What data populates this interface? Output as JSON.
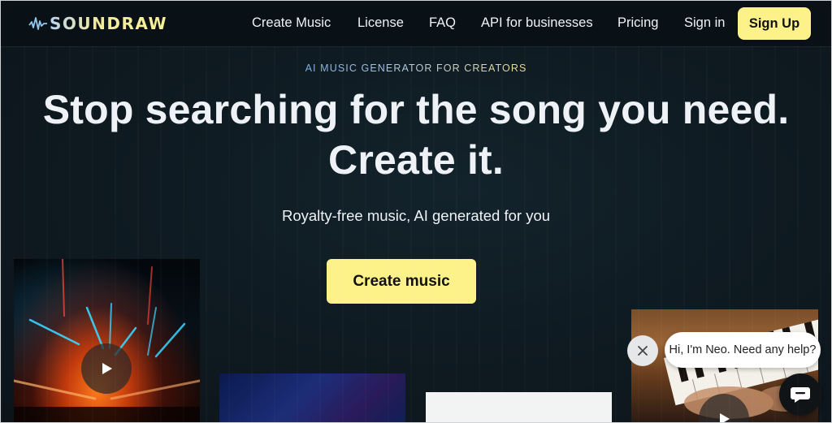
{
  "brand": {
    "name": "SOUNDRAW"
  },
  "nav": {
    "links": [
      "Create Music",
      "License",
      "FAQ",
      "API for businesses",
      "Pricing",
      "Sign in"
    ],
    "signup_label": "Sign Up"
  },
  "hero": {
    "eyebrow": "AI MUSIC GENERATOR FOR CREATORS",
    "headline_line1": "Stop searching for the song you need.",
    "headline_line2": "Create it.",
    "subhead": "Royalty-free music, AI generated for you",
    "cta_label": "Create music"
  },
  "chat": {
    "message": "Hi, I'm Neo. Need any help?",
    "close_icon": "close-icon",
    "launcher_icon": "chat-icon"
  },
  "colors": {
    "accent_yellow": "#fdf28a",
    "background": "#0e1820",
    "nav_background": "#0a1116"
  },
  "cards": [
    {
      "kind": "concert",
      "icon": "play-icon"
    },
    {
      "kind": "blue"
    },
    {
      "kind": "white"
    },
    {
      "kind": "piano",
      "icon": "play-icon"
    }
  ]
}
